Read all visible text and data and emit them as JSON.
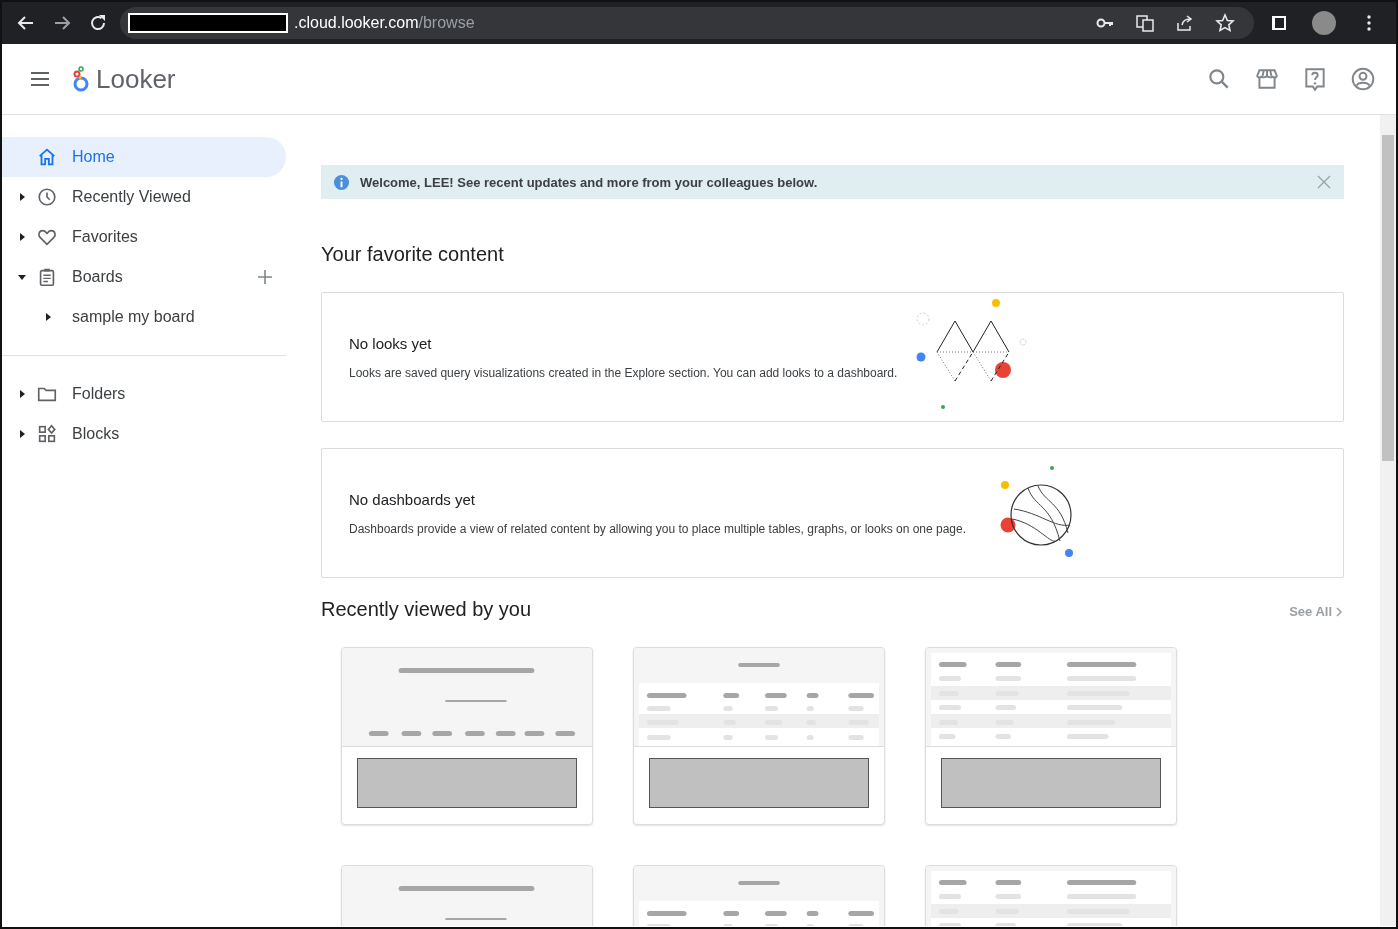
{
  "browser": {
    "url_host": ".cloud.looker.com",
    "url_path": "/browse"
  },
  "app": {
    "name": "Looker"
  },
  "sidebar": {
    "items": [
      {
        "label": "Home",
        "kind": "home",
        "selected": true
      },
      {
        "label": "Recently Viewed",
        "kind": "clock",
        "selected": false,
        "expanded": false
      },
      {
        "label": "Favorites",
        "kind": "heart",
        "selected": false,
        "expanded": false
      },
      {
        "label": "Boards",
        "kind": "board",
        "selected": false,
        "expanded": true,
        "addable": true,
        "children": [
          {
            "label": "sample my board",
            "selected": false,
            "expanded": false
          }
        ]
      }
    ],
    "items_2": [
      {
        "label": "Folders",
        "kind": "folder",
        "selected": false,
        "expanded": false
      },
      {
        "label": "Blocks",
        "kind": "blocks",
        "selected": false,
        "expanded": false
      }
    ]
  },
  "banner": {
    "text": "Welcome, LEE! See recent updates and more from your colleagues below."
  },
  "favorites": {
    "title": "Your favorite content",
    "cards": [
      {
        "title": "No looks yet",
        "description": "Looks are saved query visualizations created in the Explore section. You can add looks to a dashboard.",
        "kind": "looks"
      },
      {
        "title": "No dashboards yet",
        "description": "Dashboards provide a view of related content by allowing you to place multiple tables, graphs, or looks on one page.",
        "kind": "dashboards"
      }
    ]
  },
  "recent": {
    "title": "Recently viewed by you",
    "see_all": "See All",
    "items": [
      {
        "kind": "single"
      },
      {
        "kind": "table"
      },
      {
        "kind": "grid"
      },
      {
        "kind": "single"
      },
      {
        "kind": "table"
      },
      {
        "kind": "grid"
      }
    ]
  }
}
